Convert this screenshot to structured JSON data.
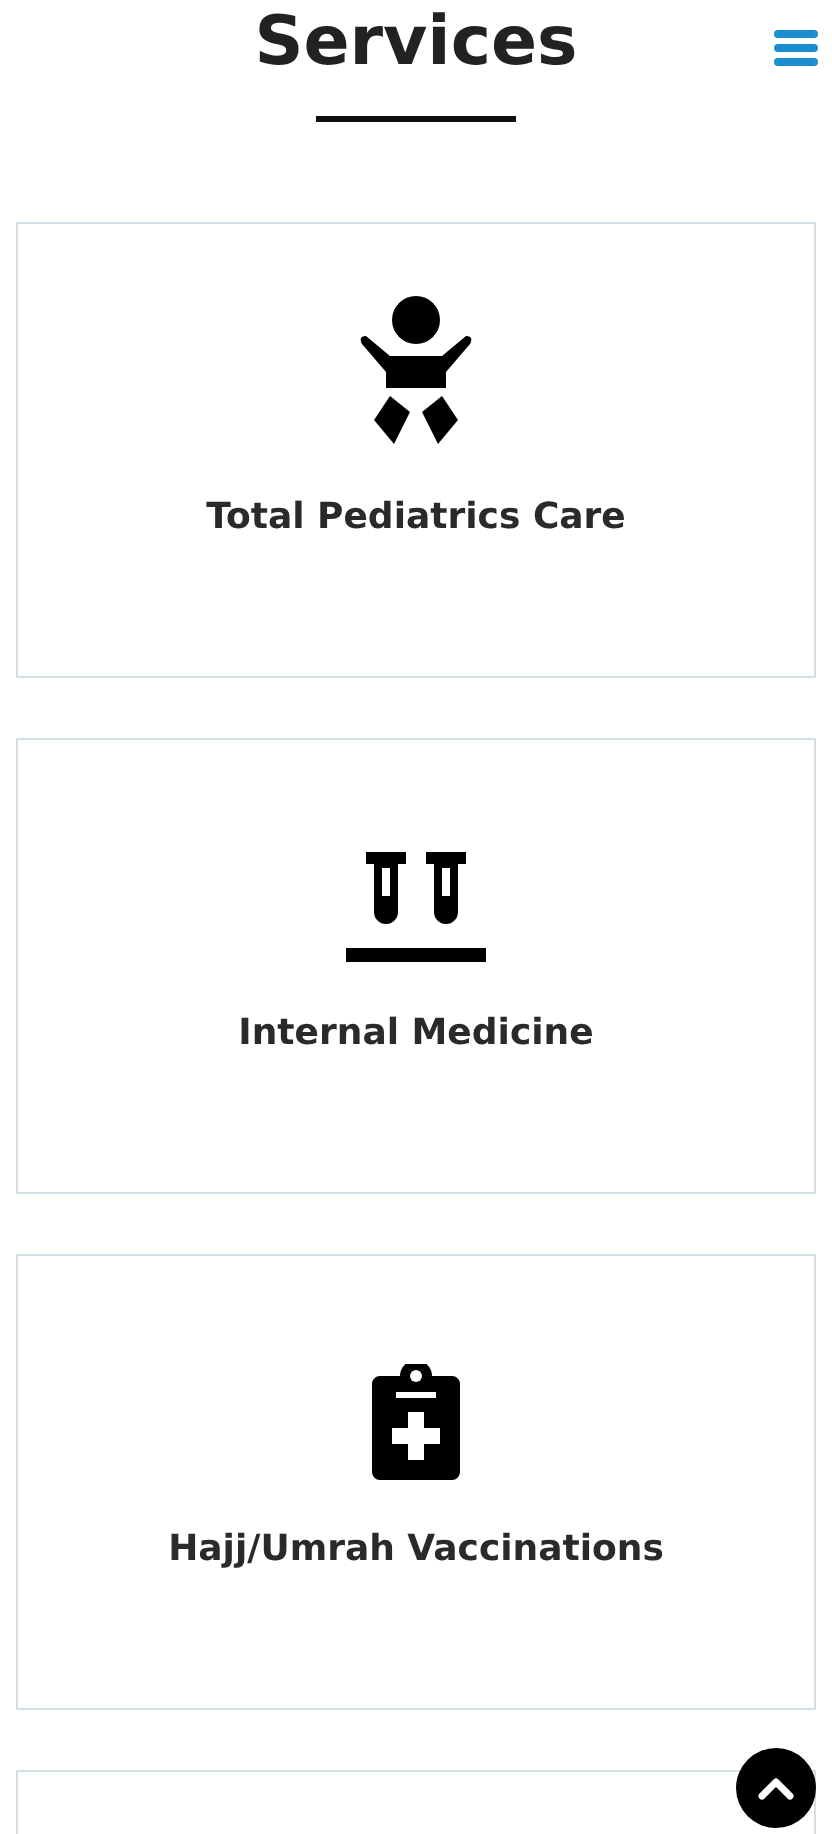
{
  "header": {
    "title": "Services"
  },
  "services": [
    {
      "title": "Total Pediatrics Care"
    },
    {
      "title": "Internal Medicine"
    },
    {
      "title": "Hajj/Umrah Vaccinations"
    }
  ]
}
